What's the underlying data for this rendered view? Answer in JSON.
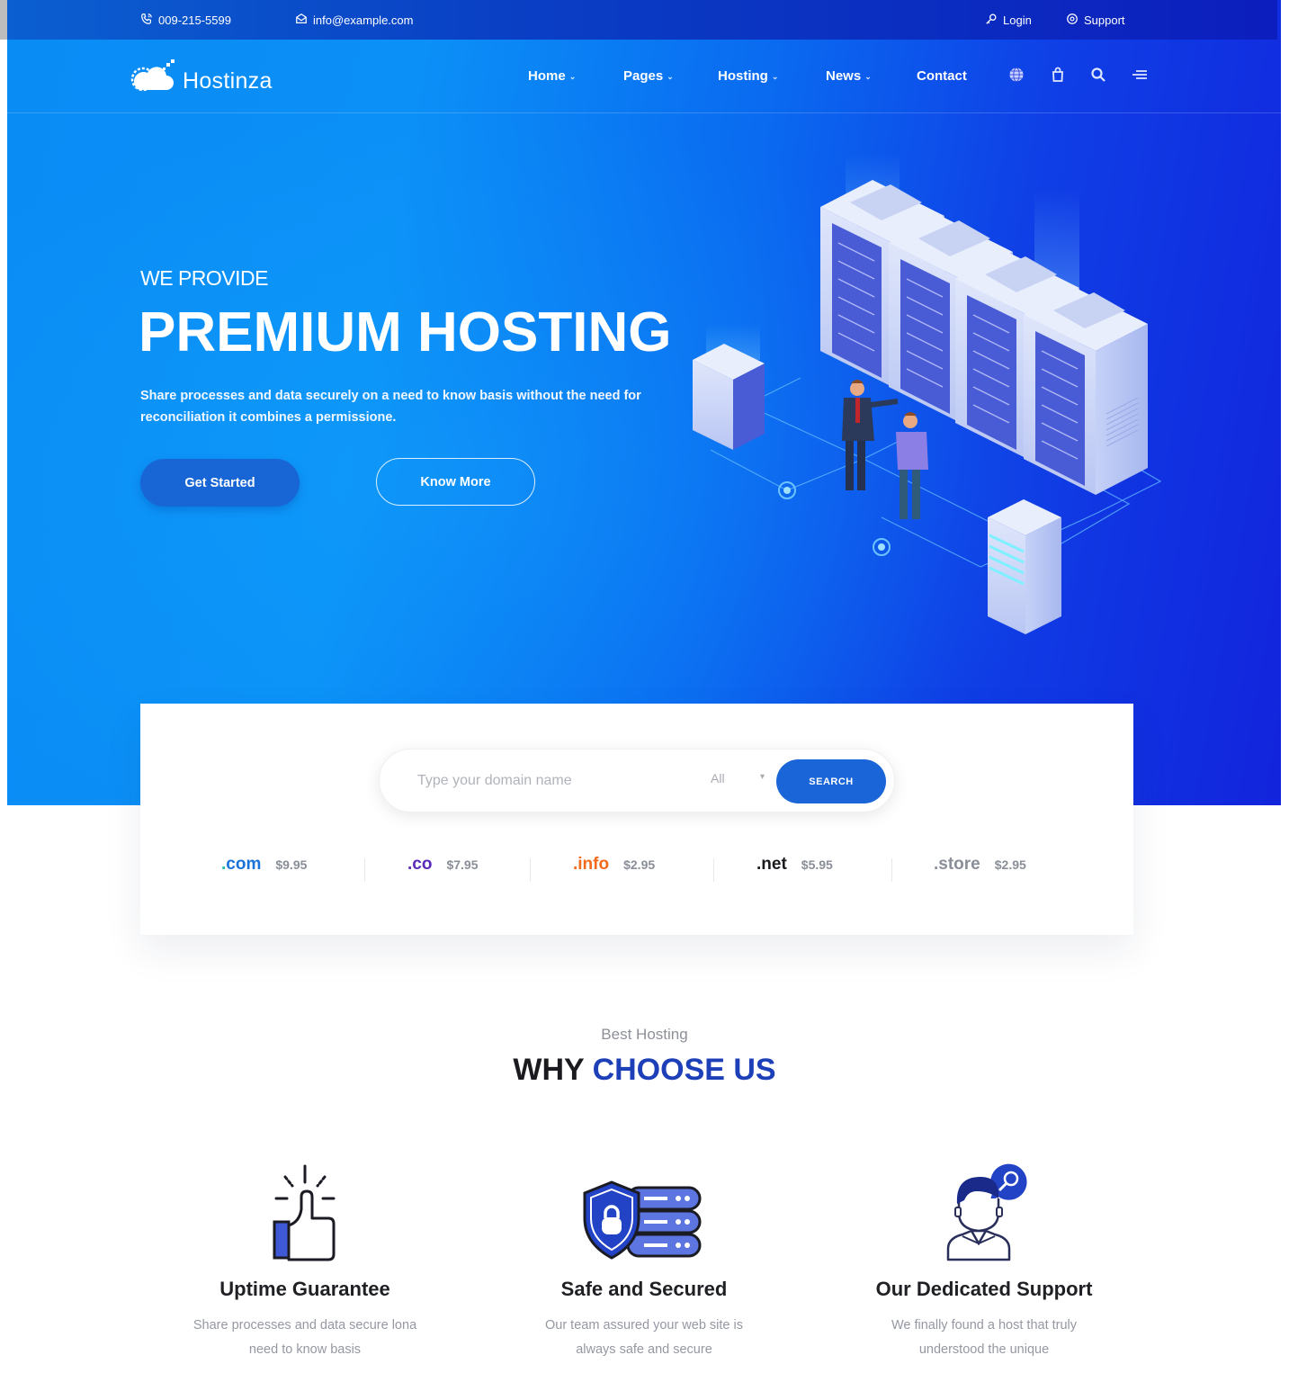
{
  "topbar": {
    "phone": "009-215-5599",
    "email": "info@example.com",
    "login": "Login",
    "support": "Support",
    "icons": {
      "phone": "phone-icon",
      "email": "envelope-icon",
      "login": "key-icon",
      "support": "lifebuoy-icon"
    }
  },
  "brand": {
    "name": "Hostinza",
    "logo_icon": "cloud-sun-icon"
  },
  "nav": {
    "items": [
      {
        "label": "Home",
        "has_dropdown": true
      },
      {
        "label": "Pages",
        "has_dropdown": true
      },
      {
        "label": "Hosting",
        "has_dropdown": true
      },
      {
        "label": "News",
        "has_dropdown": true
      },
      {
        "label": "Contact",
        "has_dropdown": false
      }
    ],
    "dropdown_glyph": "⌄",
    "icons": [
      "globe-icon",
      "shopping-bag-icon",
      "search-icon",
      "menu-icon"
    ]
  },
  "hero": {
    "kicker": "WE PROVIDE",
    "title": "PREMIUM HOSTING",
    "description": "Share processes and data securely on a need to know basis without the need for reconciliation it combines a permissione.",
    "primary_button": "Get Started",
    "secondary_button": "Know More",
    "illustration": "isometric-server-room-illustration"
  },
  "domain_search": {
    "placeholder": "Type your domain name",
    "value": "",
    "tld_select": "All",
    "button": "SEARCH",
    "tlds": [
      {
        "name": ".com",
        "price": "$9.95",
        "color": "#1a73d9"
      },
      {
        "name": ".co",
        "price": "$7.95",
        "color": "#5a2ab8"
      },
      {
        "name": ".info",
        "price": "$2.95",
        "color": "#f26b1d"
      },
      {
        "name": ".net",
        "price": "$5.95",
        "color": "#1b1b1f"
      },
      {
        "name": ".store",
        "price": "$2.95",
        "color": "#8a8e98"
      }
    ]
  },
  "why_choose": {
    "kicker": "Best Hosting",
    "title_plain": "WHY",
    "title_accent": "CHOOSE US",
    "features": [
      {
        "icon": "thumbs-up-icon",
        "title": "Uptime Guarantee",
        "desc_line1": "Share processes and data secure lona",
        "desc_line2": "need to know basis"
      },
      {
        "icon": "shield-lock-server-icon",
        "title": "Safe and Secured",
        "desc_line1": "Our team assured your web site is",
        "desc_line2": "always safe and secure"
      },
      {
        "icon": "support-agent-icon",
        "title": "Our Dedicated Support",
        "desc_line1": "We finally found a host that truly",
        "desc_line2": "understood the unique"
      }
    ]
  },
  "colors": {
    "hero_start": "#0a8cf5",
    "hero_end": "#1224dc",
    "button_primary": "#1866d6",
    "search_button": "#1a66d8",
    "title_accent": "#1d3fb8"
  }
}
